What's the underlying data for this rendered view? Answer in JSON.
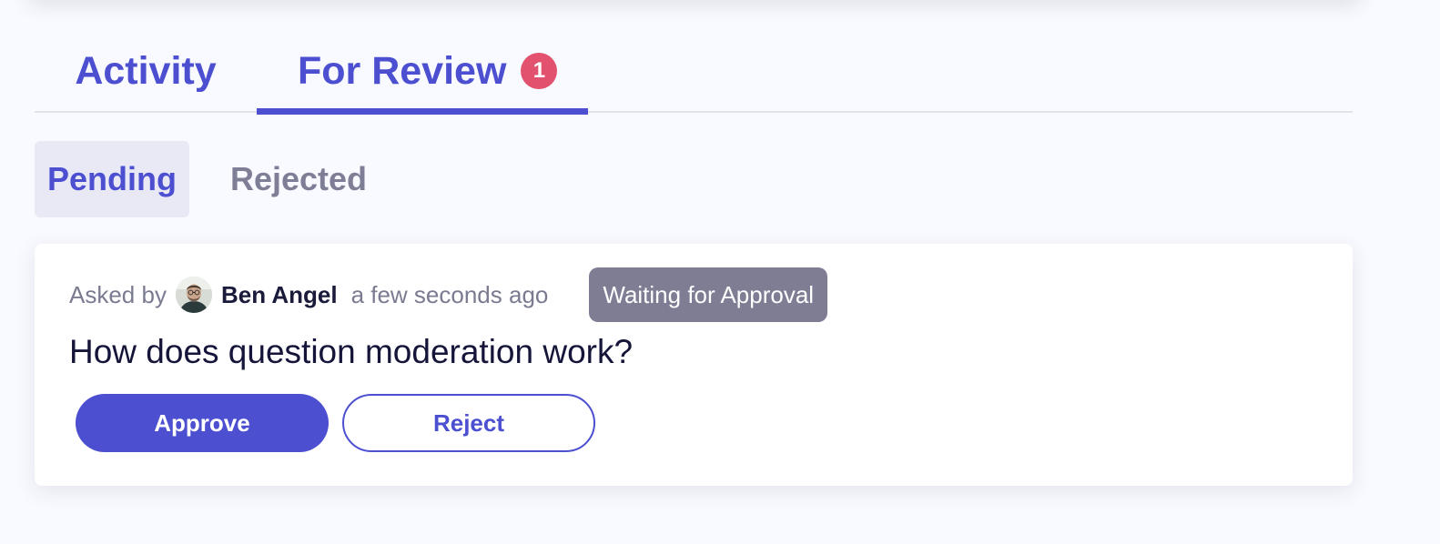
{
  "tabs": {
    "activity_label": "Activity",
    "review_label": "For Review",
    "review_count": "1",
    "active": "For Review"
  },
  "subtabs": {
    "pending_label": "Pending",
    "rejected_label": "Rejected",
    "active": "Pending"
  },
  "question_card": {
    "asked_by_label": "Asked by",
    "author_name": "Ben Angel",
    "timestamp": "a few seconds ago",
    "status": "Waiting for Approval",
    "question_text": "How does question moderation work?",
    "approve_label": "Approve",
    "reject_label": "Reject",
    "avatar_icon": "user-avatar-photo"
  },
  "colors": {
    "accent": "#4b4fd0",
    "badge": "#e2526e",
    "status_badge": "#7e7d94",
    "background": "#f9faff"
  }
}
